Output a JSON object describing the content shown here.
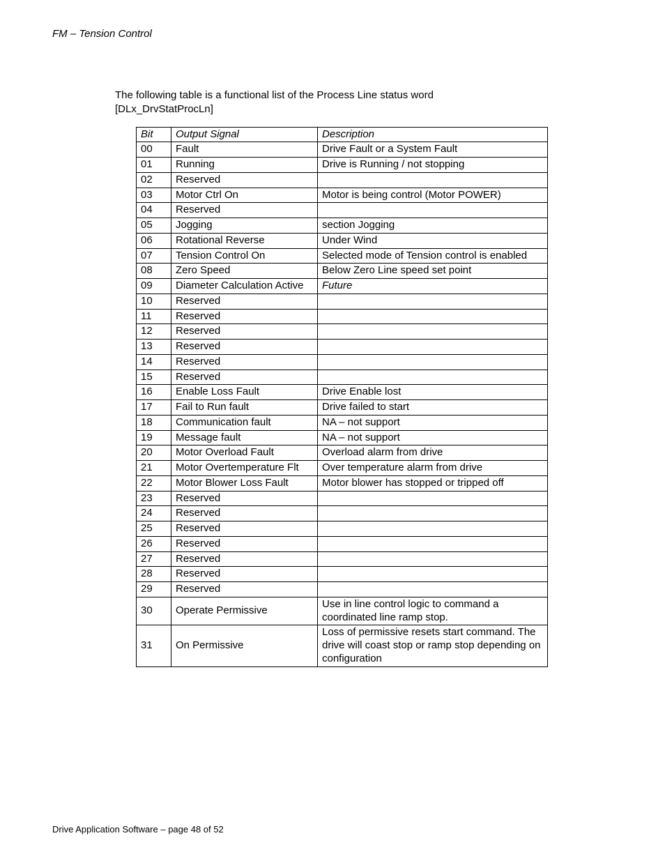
{
  "header": "FM – Tension Control",
  "intro_line1": "The following table is a functional list of the Process Line status word",
  "intro_line2": "[DLx_DrvStatProcLn]",
  "columns": {
    "c1": "Bit",
    "c2": "Output Signal",
    "c3": "Description"
  },
  "rows": [
    {
      "bit": "00",
      "signal": "Fault",
      "desc": "Drive Fault or a System Fault"
    },
    {
      "bit": "01",
      "signal": "Running",
      "desc": "Drive is Running / not stopping"
    },
    {
      "bit": "02",
      "signal": "Reserved",
      "desc": ""
    },
    {
      "bit": "03",
      "signal": "Motor Ctrl On",
      "desc": "Motor is being control (Motor POWER)"
    },
    {
      "bit": "04",
      "signal": "Reserved",
      "desc": ""
    },
    {
      "bit": "05",
      "signal": "Jogging",
      "desc": "section Jogging"
    },
    {
      "bit": "06",
      "signal": "Rotational Reverse",
      "desc": "Under Wind"
    },
    {
      "bit": "07",
      "signal": "Tension Control On",
      "desc": "Selected mode of Tension control is enabled"
    },
    {
      "bit": "08",
      "signal": "Zero Speed",
      "desc": "Below Zero Line speed set point"
    },
    {
      "bit": "09",
      "signal": "Diameter Calculation Active",
      "desc": "Future",
      "descItalic": true
    },
    {
      "bit": "10",
      "signal": "Reserved",
      "desc": ""
    },
    {
      "bit": "11",
      "signal": "Reserved",
      "desc": ""
    },
    {
      "bit": "12",
      "signal": "Reserved",
      "desc": ""
    },
    {
      "bit": "13",
      "signal": "Reserved",
      "desc": ""
    },
    {
      "bit": "14",
      "signal": "Reserved",
      "desc": ""
    },
    {
      "bit": "15",
      "signal": "Reserved",
      "desc": ""
    },
    {
      "bit": "16",
      "signal": "Enable Loss Fault",
      "desc": "Drive Enable lost"
    },
    {
      "bit": "17",
      "signal": "Fail to Run fault",
      "desc": "Drive failed to start"
    },
    {
      "bit": "18",
      "signal": "Communication fault",
      "desc": "NA – not support"
    },
    {
      "bit": "19",
      "signal": "Message fault",
      "desc": "NA – not support"
    },
    {
      "bit": "20",
      "signal": "Motor Overload Fault",
      "desc": "Overload alarm from drive"
    },
    {
      "bit": "21",
      "signal": "Motor Overtemperature Flt",
      "desc": "Over temperature alarm from drive"
    },
    {
      "bit": "22",
      "signal": "Motor Blower Loss Fault",
      "desc": "Motor blower has stopped or tripped off"
    },
    {
      "bit": "23",
      "signal": "Reserved",
      "desc": ""
    },
    {
      "bit": "24",
      "signal": "Reserved",
      "desc": ""
    },
    {
      "bit": "25",
      "signal": "Reserved",
      "desc": ""
    },
    {
      "bit": "26",
      "signal": "Reserved",
      "desc": ""
    },
    {
      "bit": "27",
      "signal": "Reserved",
      "desc": ""
    },
    {
      "bit": "28",
      "signal": "Reserved",
      "desc": ""
    },
    {
      "bit": "29",
      "signal": "Reserved",
      "desc": ""
    },
    {
      "bit": "30",
      "signal": "Operate Permissive",
      "desc": "Use in line control logic to command a coordinated line ramp stop.",
      "vcenter": true
    },
    {
      "bit": "31",
      "signal": "On Permissive",
      "desc": "Loss of permissive resets start command. The drive will coast stop or ramp stop depending on configuration",
      "vcenter": true
    }
  ],
  "footer": "Drive Application Software – page 48 of 52"
}
